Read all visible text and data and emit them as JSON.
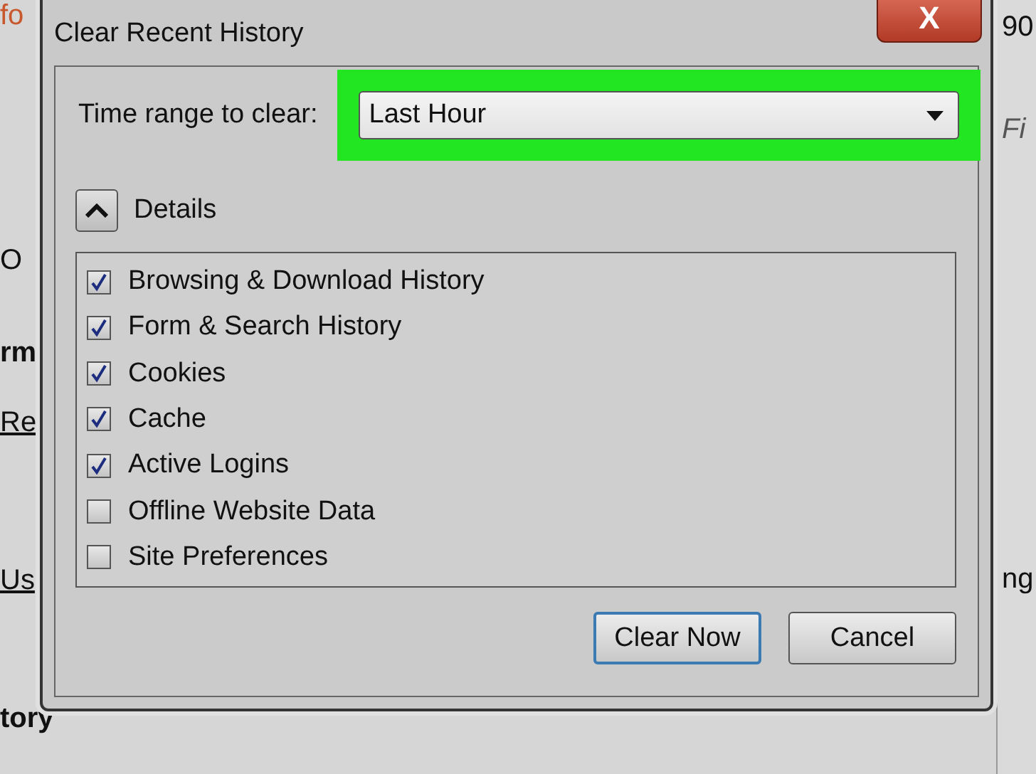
{
  "background": {
    "fragments": [
      {
        "text": "fo",
        "kind": "brand"
      },
      {
        "text": "O",
        "kind": "plain"
      },
      {
        "text": "rm",
        "kind": "heading"
      },
      {
        "text": "Re",
        "kind": "link"
      },
      {
        "text": "Us",
        "kind": "link"
      },
      {
        "text": "tory",
        "kind": "heading"
      }
    ],
    "right_fragments": [
      {
        "text": "90",
        "kind": "plain"
      },
      {
        "text": "Fi",
        "kind": "search"
      },
      {
        "text": "ng",
        "kind": "plain"
      }
    ]
  },
  "window": {
    "title": "Clear Recent History",
    "close_label": "X"
  },
  "time_range": {
    "label": "Time range to clear:",
    "value": "Last Hour",
    "highlighted": true
  },
  "details": {
    "label": "Details",
    "expanded": true
  },
  "items": [
    {
      "label": "Browsing & Download History",
      "checked": true
    },
    {
      "label": "Form & Search History",
      "checked": true
    },
    {
      "label": "Cookies",
      "checked": true
    },
    {
      "label": "Cache",
      "checked": true
    },
    {
      "label": "Active Logins",
      "checked": true
    },
    {
      "label": "Offline Website Data",
      "checked": false
    },
    {
      "label": "Site Preferences",
      "checked": false
    }
  ],
  "buttons": [
    {
      "label": "Clear Now",
      "kind": "default"
    },
    {
      "label": "Cancel",
      "kind": "normal"
    }
  ]
}
